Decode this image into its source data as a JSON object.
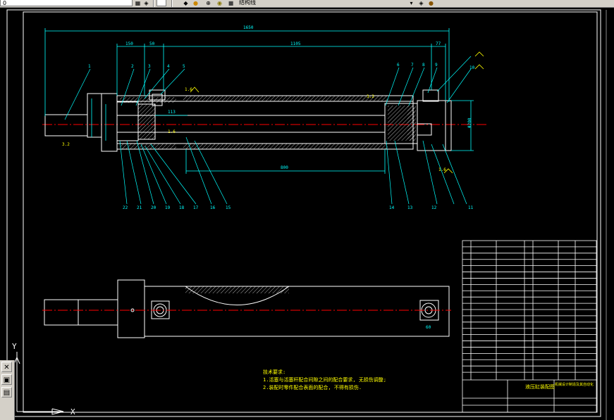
{
  "toolbar": {
    "layer_field": "0",
    "linetype_field": "",
    "style_field": "结构线",
    "dropdown_icon": "chevron-down-icon"
  },
  "colors": {
    "background": "#000000",
    "geometry": "#ffffff",
    "dimension": "#00ffff",
    "center_line": "#ff0000",
    "hatch": "#ffffff",
    "text_yellow": "#ffff00"
  },
  "drawing": {
    "dims": {
      "overall_length": "1650",
      "d_150": "150",
      "d_50": "50",
      "d_1105": "1105",
      "d_77": "77",
      "d_800": "800",
      "d_113": "113",
      "d_200": "Φ200",
      "d_60": "60"
    },
    "balloons": [
      "1",
      "2",
      "3",
      "4",
      "5",
      "6",
      "7",
      "8",
      "9",
      "10",
      "11",
      "12",
      "13",
      "14",
      "15",
      "16",
      "17",
      "18",
      "19",
      "20",
      "21",
      "22"
    ],
    "roughness": [
      "1.6",
      "1.6",
      "1.6",
      "3.2",
      "3.2"
    ],
    "tech_req": {
      "title": "技术要求:",
      "line1": "1.活塞与活塞杆配合间隙之间的配合要求, 无损伤调整;",
      "line2": "2.装配时零件配合表面的配合, 不得有损伤."
    },
    "title_block": {
      "drawing_name": "液压缸装配图",
      "school": "机械设计制造及其自动化"
    },
    "axis": {
      "y": "Y",
      "x": "X"
    }
  },
  "leftstrip": {
    "icons": [
      "close-icon",
      "model-space-icon",
      "layout-icon"
    ]
  }
}
